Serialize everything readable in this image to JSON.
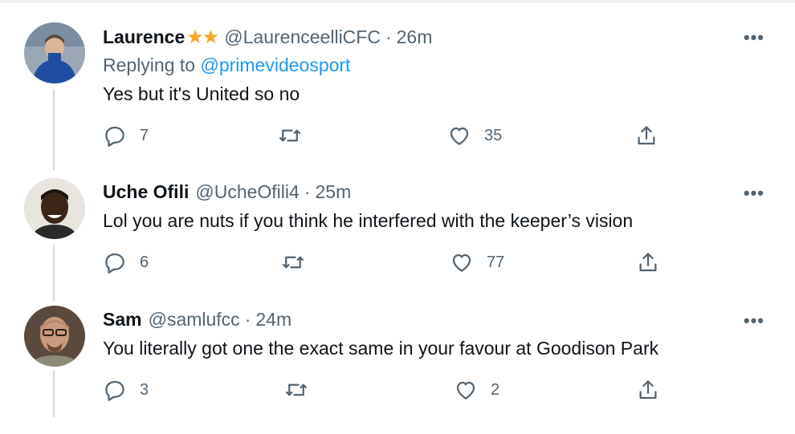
{
  "tweets": [
    {
      "name": "Laurence",
      "badge": "★★",
      "handle": "@LaurenceelliCFC",
      "separator": "·",
      "time": "26m",
      "replying_prefix": "Replying to",
      "replying_to": "@primevideosport",
      "text": "Yes but it's United so no",
      "reply_count": "7",
      "retweet_count": "",
      "like_count": "35"
    },
    {
      "name": "Uche Ofili",
      "handle": "@UcheOfili4",
      "separator": "·",
      "time": "25m",
      "text": "Lol you are nuts if you think he interfered with the keeper’s vision",
      "reply_count": "6",
      "retweet_count": "",
      "like_count": "77"
    },
    {
      "name": "Sam",
      "handle": "@samlufcc",
      "separator": "·",
      "time": "24m",
      "text": "You literally got one the exact same in your favour at Goodison Park",
      "reply_count": "3",
      "retweet_count": "",
      "like_count": "2"
    }
  ],
  "icons": {
    "more": "more-icon",
    "reply": "reply-icon",
    "retweet": "retweet-icon",
    "like": "like-icon",
    "share": "share-icon"
  },
  "colors": {
    "link": "#1d9bf0",
    "secondary_text": "#536471",
    "primary_text": "#0f1419",
    "thread_line": "#cfd9de",
    "star": "#f5a623"
  }
}
